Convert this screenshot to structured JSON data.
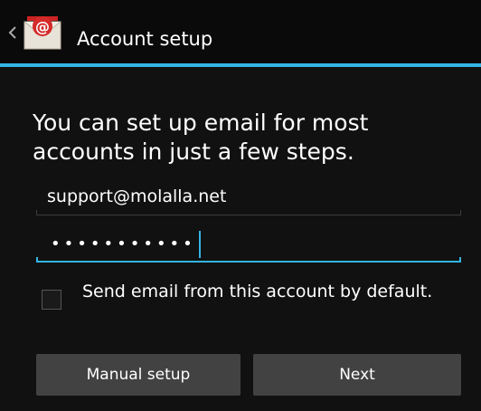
{
  "action_bar": {
    "title": "Account setup",
    "back_icon": "chevron-left-icon",
    "app_icon": "email-app-icon"
  },
  "main": {
    "intro_text": "You can set up email for most accounts in just a few steps.",
    "email": {
      "value": "support@molalla.net"
    },
    "password": {
      "masked_value": "•••••••••••"
    },
    "default_checkbox": {
      "label": "Send email from this account by default.",
      "checked": false
    },
    "buttons": {
      "manual_setup": "Manual setup",
      "next": "Next"
    }
  },
  "colors": {
    "accent": "#33b5e5",
    "background": "#111111",
    "button": "#424242"
  }
}
